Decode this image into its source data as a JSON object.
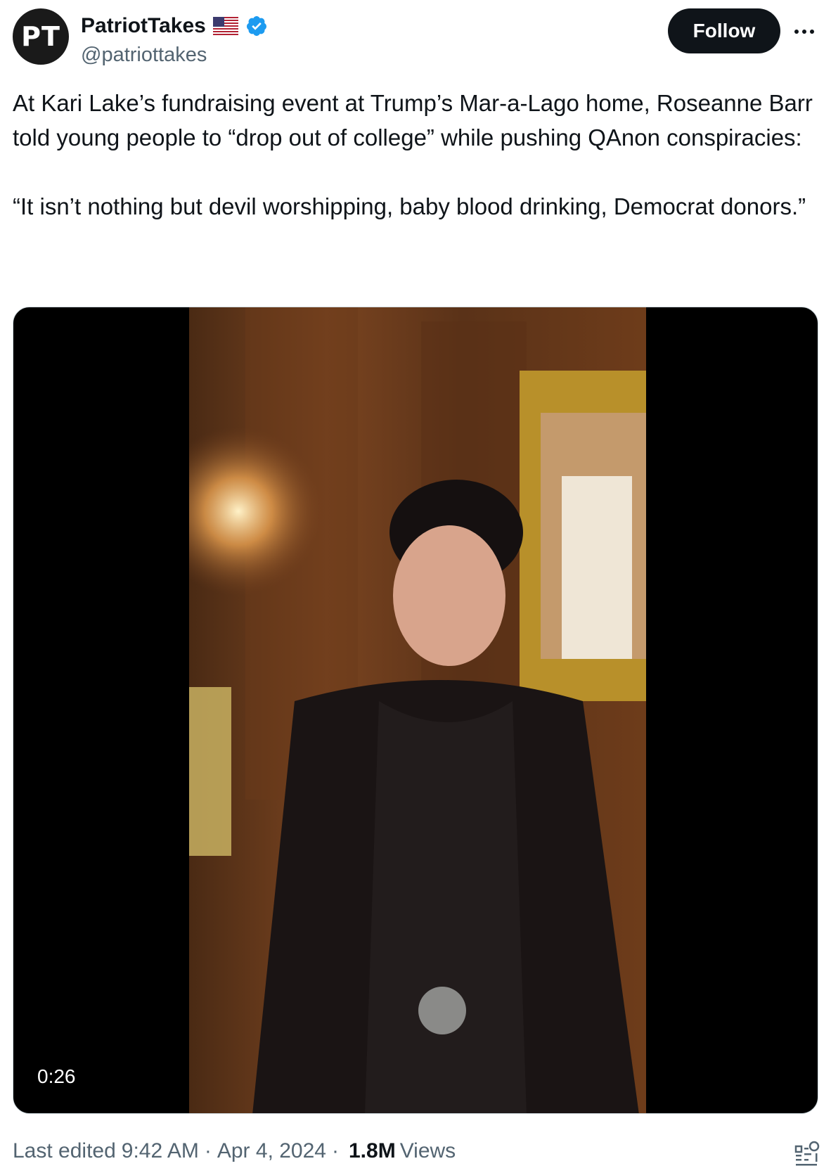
{
  "author": {
    "initials": "PT",
    "name": "PatriotTakes",
    "handle": "@patriottakes",
    "verified_color": "#1d9bf0"
  },
  "actions": {
    "follow_label": "Follow",
    "more_icon": "more-icon"
  },
  "tweet": {
    "paragraph_1": "At Kari Lake’s fundraising event at Trump’s Mar-a-Lago home, Roseanne Barr told young people to “drop out of college” while pushing QAnon conspiracies:",
    "paragraph_2": "“It isn’t nothing but devil worshipping, baby blood drinking, Democrat donors.”"
  },
  "media": {
    "type": "video",
    "duration": "0:26"
  },
  "meta": {
    "edited_label": "Last edited",
    "time": "9:42 AM",
    "separator": "·",
    "date": "Apr 4, 2024",
    "views_count": "1.8M",
    "views_label": "Views"
  },
  "colors": {
    "text": "#0f1419",
    "secondary": "#536471",
    "button_bg": "#0f1419"
  }
}
